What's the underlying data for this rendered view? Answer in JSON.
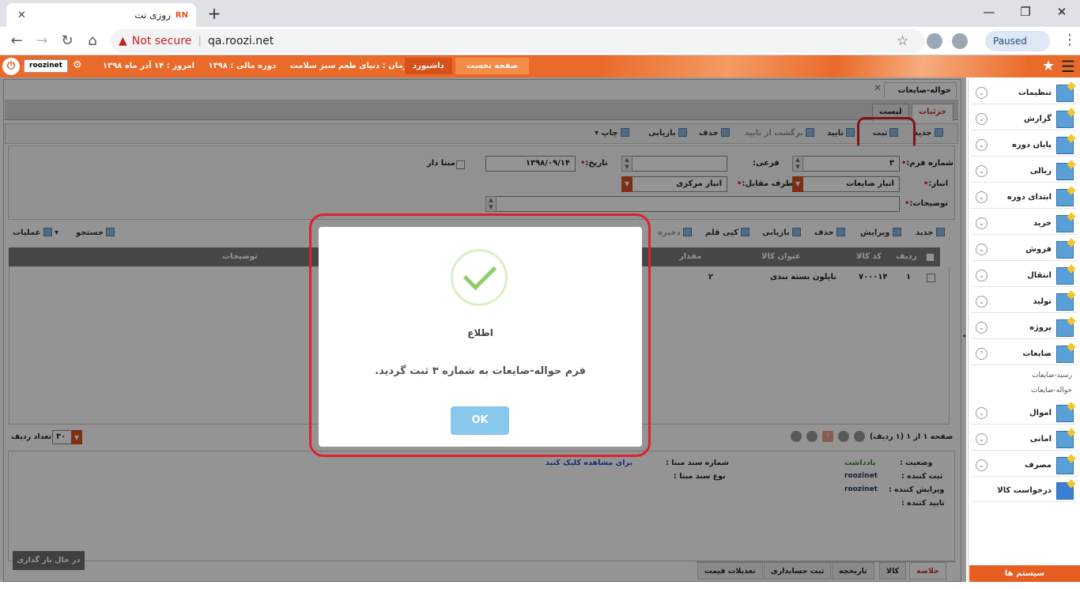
{
  "browser": {
    "tab_title": "روزی نت",
    "tab_favicon": "RN",
    "url": "qa.roozi.net",
    "security_text": "Not secure",
    "profile_status": "Paused"
  },
  "appbar": {
    "username": "roozinet",
    "org_label": "سازمان :",
    "org_value": "دنیای طعم سبز سلامت",
    "fiscal_label": "دوره مالی :",
    "fiscal_value": "۱۳۹۸",
    "today_label": "امروز :",
    "today_value": "۱۴ آذر ماه ۱۳۹۸",
    "dashboard": "داشبورد",
    "home": "صفحه نخست"
  },
  "sidebar": {
    "items": [
      {
        "label": "تنظیمات"
      },
      {
        "label": "گزارش"
      },
      {
        "label": "پایان دوره"
      },
      {
        "label": "ریالی"
      },
      {
        "label": "ابتدای دوره"
      },
      {
        "label": "خرید"
      },
      {
        "label": "فروش"
      },
      {
        "label": "انتقال"
      },
      {
        "label": "تولید"
      },
      {
        "label": "پروژه"
      },
      {
        "label": "ضایعات"
      },
      {
        "label": "اموال"
      },
      {
        "label": "امانی"
      },
      {
        "label": "مصرف"
      },
      {
        "label": "درخواست کالا"
      }
    ],
    "sub_items": [
      "رسید-ضایعات",
      "حواله-ضایعات"
    ],
    "system_button": "سیستم ها"
  },
  "document": {
    "tab_title": "حواله-ضایعات",
    "view_tabs": [
      "جزئیات",
      "لیست"
    ]
  },
  "toolbar": {
    "new": "جدید",
    "register": "ثبت",
    "confirm": "تایید",
    "unconfirm": "برگشت از تایید",
    "delete": "حذف",
    "refresh": "بازیابی",
    "print": "چاپ"
  },
  "form": {
    "form_no_label": "شماره فرم:",
    "form_no_value": "۳",
    "sub_label": "فرعی:",
    "date_label": "تاریخ:",
    "date_value": "۱۳۹۸/۰۹/۱۴",
    "based_label": "مبنا دار",
    "warehouse_label": "انبار:",
    "warehouse_value": "انبار ضایعات",
    "counterpart_label": "طرف مقابل:",
    "counterpart_value": "انبار مرکزی",
    "desc_label": "توضیحات:"
  },
  "grid_toolbar": {
    "new": "جدید",
    "edit": "ویرایش",
    "delete": "حذف",
    "refresh": "بازیابی",
    "copy": "کپی قلم",
    "save": "ذخیره",
    "search": "جستجو",
    "ops": "عملیات"
  },
  "grid": {
    "columns": [
      "ردیف",
      "کد کالا",
      "عنوان کالا",
      "مقدار",
      "توضیحات"
    ],
    "rows": [
      {
        "idx": "۱",
        "code": "۷۰۰۰۱۴",
        "title": "نایلون بسته بندی",
        "qty": "۲"
      }
    ]
  },
  "pager": {
    "info": "صفحه ۱ از ۱ (۱ ردیف)",
    "page": "۱",
    "size": "۳۰",
    "size_label": "تعداد ردیف"
  },
  "info": {
    "status_label": "وضعیت :",
    "status_value": "یادداشت",
    "creator_label": "ثبت کننده :",
    "creator_value": "roozinet",
    "editor_label": "ویرایش کننده :",
    "editor_value": "roozinet",
    "approver_label": "تایید کننده :",
    "source_no_label": "شماره سند مبنا :",
    "source_type_label": "نوع سند مبنا :",
    "view_link": "برای مشاهده کلیک کنید"
  },
  "loading": "در حال بار گذاری ...",
  "bottom_tabs": [
    "خلاصه",
    "کالا",
    "تاریخچه",
    "ثبت حسابداری",
    "تعدیلات قیمت"
  ],
  "dialog": {
    "title": "اطلاع",
    "message": "فرم حواله-ضایعات به شماره ۳ ثبت گردید.",
    "ok": "OK"
  },
  "colors": {
    "accent": "#ea6a2a",
    "highlight": "#e0202a",
    "ok_button": "#87c8ec",
    "success": "#90cc6a"
  }
}
